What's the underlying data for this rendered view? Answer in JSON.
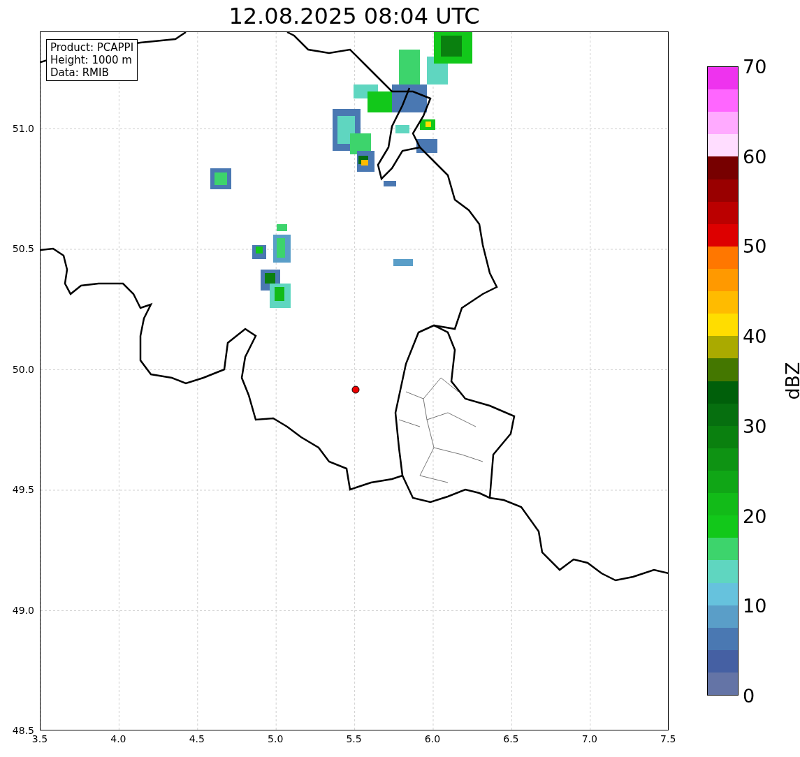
{
  "title": "12.08.2025 08:04 UTC",
  "info_box": [
    "Product: PCAPPI",
    "Height: 1000 m",
    "Data: RMIB"
  ],
  "map": {
    "xticks": [
      "3.5",
      "4.0",
      "4.5",
      "5.0",
      "5.5",
      "6.0",
      "6.5",
      "7.0",
      "7.5"
    ],
    "yticks": [
      "51.0",
      "50.5",
      "50.0",
      "49.5",
      "49.0",
      "48.5"
    ]
  },
  "colorbar": {
    "label": "dBZ",
    "ticks": [
      "70",
      "60",
      "50",
      "40",
      "30",
      "20",
      "10",
      "0"
    ],
    "bands": [
      {
        "color": "#ee33ee"
      },
      {
        "color": "#ff66ff"
      },
      {
        "color": "#ffaaff"
      },
      {
        "color": "#ffddff"
      },
      {
        "color": "#770000"
      },
      {
        "color": "#990000"
      },
      {
        "color": "#bb0000"
      },
      {
        "color": "#dd0000"
      },
      {
        "color": "#ff7700"
      },
      {
        "color": "#ff9900"
      },
      {
        "color": "#ffbb00"
      },
      {
        "color": "#ffdd00"
      },
      {
        "color": "#aaaa00"
      },
      {
        "color": "#447700"
      },
      {
        "color": "#005f0a"
      },
      {
        "color": "#066f0f"
      },
      {
        "color": "#0a800f"
      },
      {
        "color": "#0e9313"
      },
      {
        "color": "#10a616"
      },
      {
        "color": "#12bb18"
      },
      {
        "color": "#12c81a"
      },
      {
        "color": "#3dd46c"
      },
      {
        "color": "#5fd6c0"
      },
      {
        "color": "#66c2dd"
      },
      {
        "color": "#5a9ec8"
      },
      {
        "color": "#4a78b2"
      },
      {
        "color": "#4560a3"
      },
      {
        "color": "#6474a6"
      }
    ]
  }
}
